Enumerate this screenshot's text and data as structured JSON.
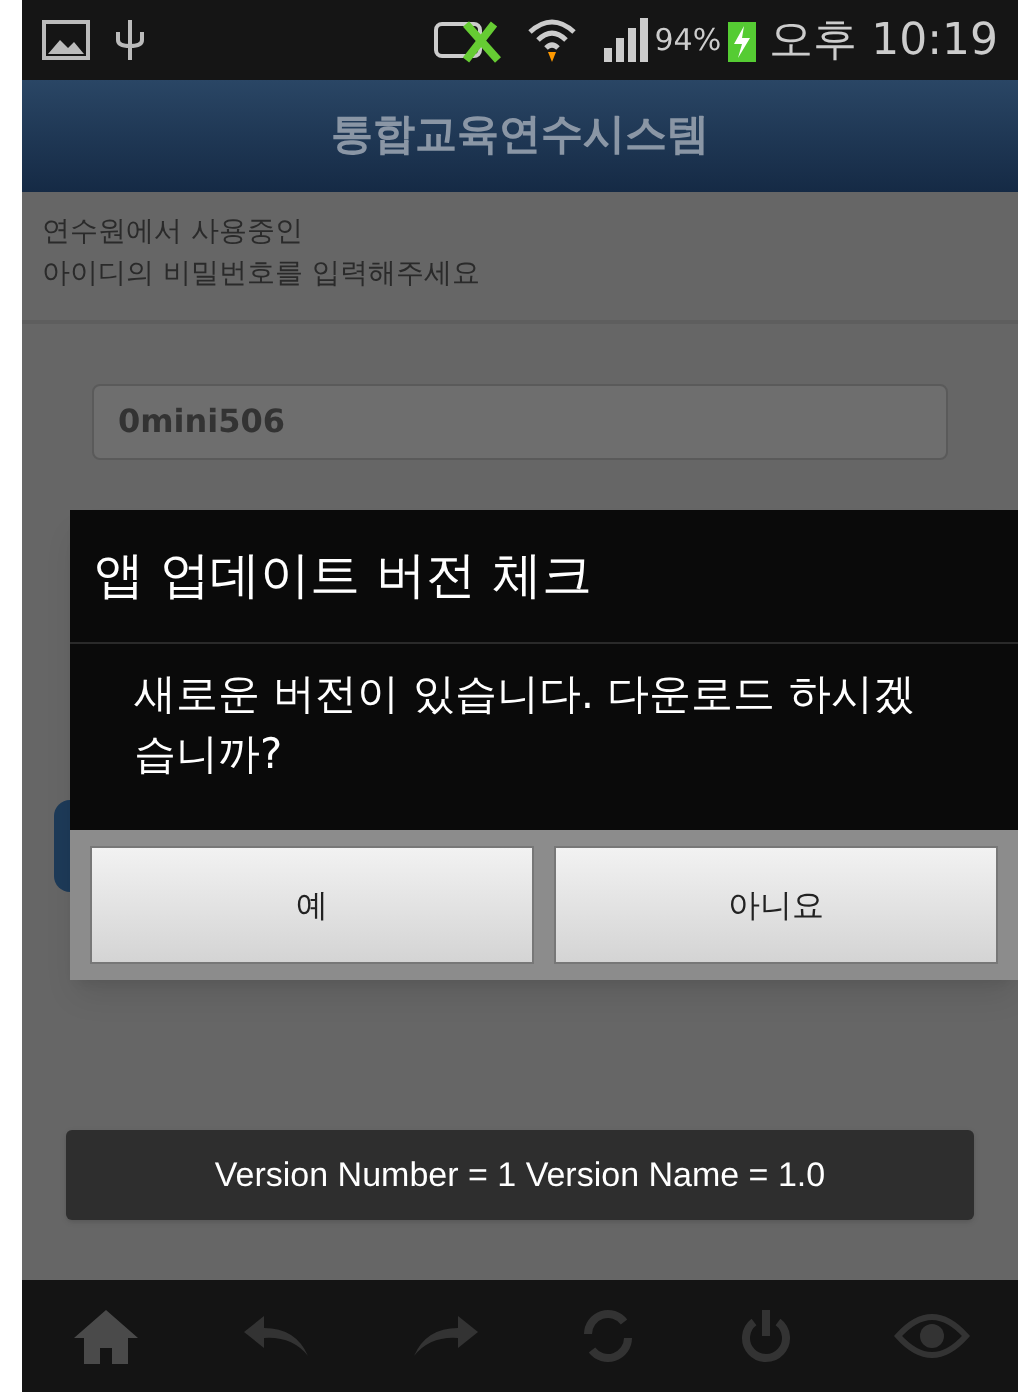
{
  "status_bar": {
    "battery": "94%",
    "time": "오후 10:19"
  },
  "header": {
    "title": "통합교육연수시스템"
  },
  "instruction": [
    "연수원에서 사용중인",
    "아이디의 비밀번호를 입력해주세요"
  ],
  "id_field": {
    "value": "0mini506"
  },
  "dialog": {
    "title": "앱 업데이트 버전 체크",
    "message": "새로운 버전이 있습니다. 다운로드 하시겠습니까?",
    "buttons": [
      "예",
      "아니요"
    ]
  },
  "toast": {
    "text": "Version Number = 1 Version Name = 1.0"
  }
}
